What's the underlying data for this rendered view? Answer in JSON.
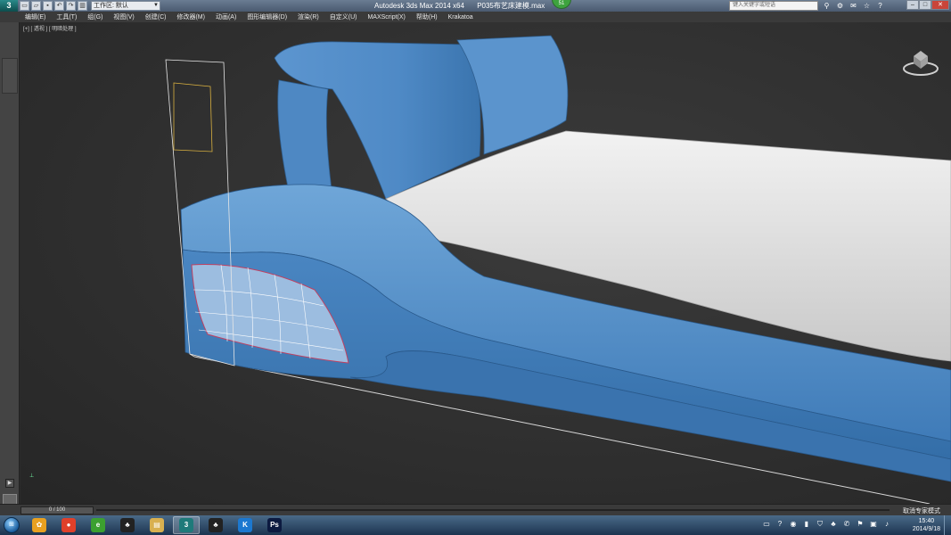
{
  "titlebar": {
    "app_title": "Autodesk 3ds Max  2014 x64",
    "file_name": "P035布艺床建模.max",
    "workspace": "工作区: 默认",
    "badge_count": "51",
    "search_placeholder": "键入关键字或短语"
  },
  "menu": {
    "items": [
      "编辑(E)",
      "工具(T)",
      "组(G)",
      "视图(V)",
      "创建(C)",
      "修改器(M)",
      "动画(A)",
      "图形编辑器(D)",
      "渲染(R)",
      "自定义(U)",
      "MAXScript(X)",
      "帮助(H)",
      "Krakatoa"
    ]
  },
  "viewport": {
    "label": "[+] [ 透视 ] [ 明暗处理 ]"
  },
  "timeline": {
    "frame_counter": "0 / 100"
  },
  "status": {
    "text": "取消专家模式"
  },
  "taskbar": {
    "apps": [
      {
        "name": "pinwheel-app-icon",
        "glyph": "✿",
        "color": "#e8a020",
        "active": false
      },
      {
        "name": "browser-icon",
        "glyph": "●",
        "color": "#e0402a",
        "active": false
      },
      {
        "name": "ie-icon",
        "glyph": "e",
        "color": "#3ca030",
        "active": false
      },
      {
        "name": "qq-penguin-icon",
        "glyph": "♣",
        "color": "#222222",
        "active": false
      },
      {
        "name": "explorer-folder-icon",
        "glyph": "▤",
        "color": "#d8b050",
        "active": false
      },
      {
        "name": "3dsmax-icon",
        "glyph": "3",
        "color": "#1e7a7a",
        "active": true
      },
      {
        "name": "qq-penguin-icon-2",
        "glyph": "♣",
        "color": "#222222",
        "active": false
      },
      {
        "name": "kugou-icon",
        "glyph": "K",
        "color": "#1c78d0",
        "active": false
      },
      {
        "name": "photoshop-icon",
        "glyph": "Ps",
        "color": "#0c1a40",
        "active": false
      }
    ],
    "time": "15:40",
    "date": "2014/9/18"
  }
}
